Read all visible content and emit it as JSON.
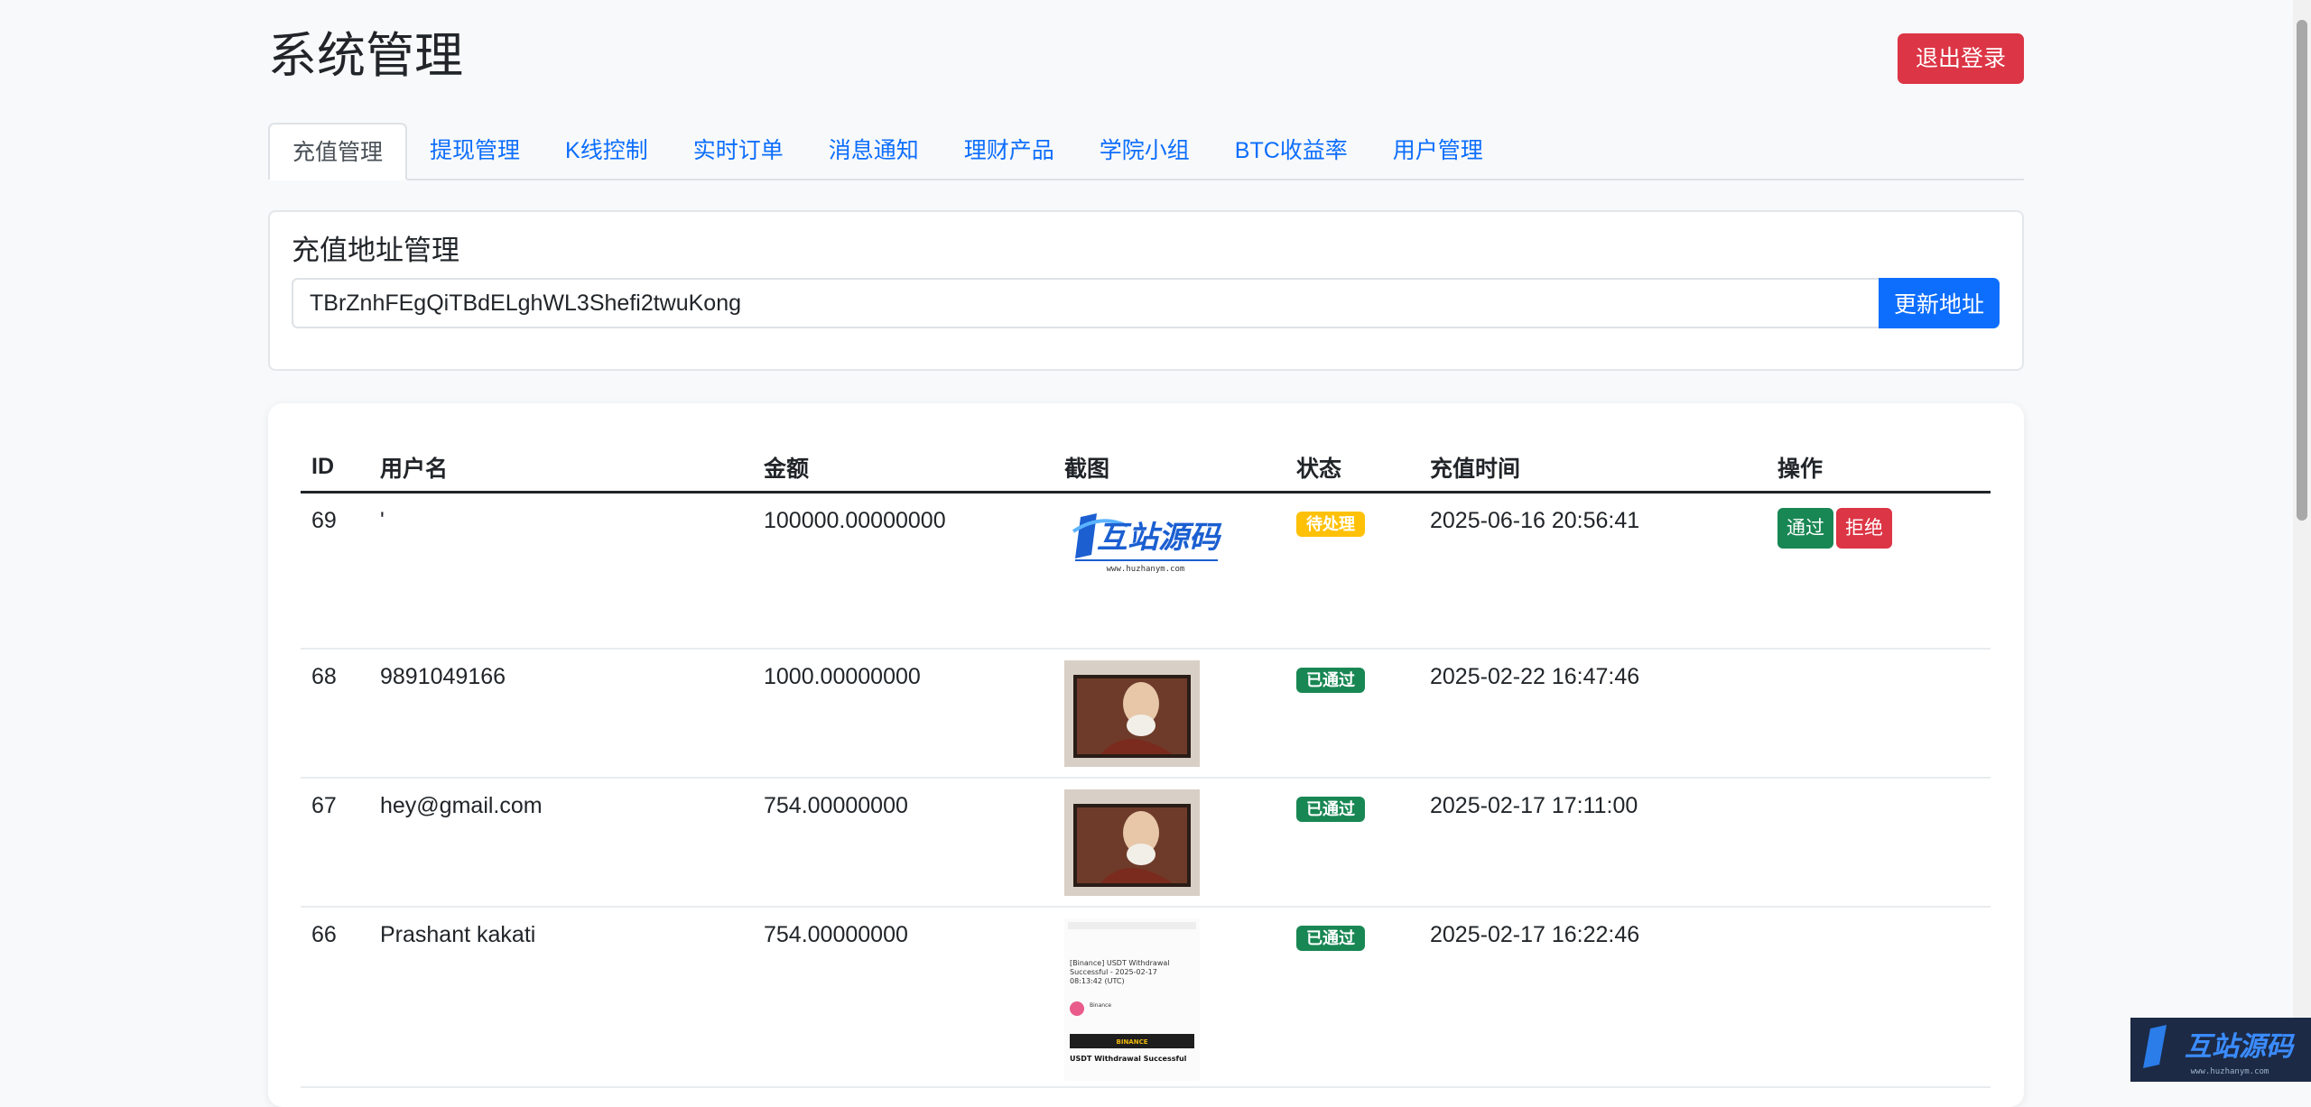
{
  "header": {
    "title": "系统管理",
    "logout_label": "退出登录"
  },
  "tabs": [
    {
      "label": "充值管理",
      "active": true
    },
    {
      "label": "提现管理"
    },
    {
      "label": "K线控制"
    },
    {
      "label": "实时订单"
    },
    {
      "label": "消息通知"
    },
    {
      "label": "理财产品"
    },
    {
      "label": "学院小组"
    },
    {
      "label": "BTC收益率"
    },
    {
      "label": "用户管理"
    }
  ],
  "address": {
    "title": "充值地址管理",
    "value": "TBrZnhFEgQiTBdELghWL3Shefi2twuKong",
    "update_label": "更新地址"
  },
  "table": {
    "columns": [
      "ID",
      "用户名",
      "金额",
      "截图",
      "状态",
      "充值时间",
      "操作"
    ],
    "rows": [
      {
        "id": "69",
        "username": "'",
        "amount": "100000.00000000",
        "status": "待处理",
        "time": "2025-06-16 20:56:41",
        "thumb_brand": "互站源码",
        "thumb_url": "www.huzhanym.com",
        "actions": [
          "通过",
          "拒绝"
        ]
      },
      {
        "id": "68",
        "username": "9891049166",
        "amount": "1000.00000000",
        "status": "已通过",
        "time": "2025-02-22 16:47:46"
      },
      {
        "id": "67",
        "username": "hey@gmail.com",
        "amount": "754.00000000",
        "status": "已通过",
        "time": "2025-02-17 17:11:00"
      },
      {
        "id": "66",
        "username": "Prashant kakati",
        "amount": "754.00000000",
        "status": "已通过",
        "time": "2025-02-17 16:22:46",
        "thumb_lines": [
          "[Binance] USDT Withdrawal",
          "Successful - 2025-02-17",
          "08:13:42 (UTC)",
          "Binance",
          "BINANCE",
          "USDT Withdrawal Successful"
        ]
      }
    ]
  },
  "watermark": {
    "brand": "互站源码",
    "url": "www.huzhanym.com"
  },
  "colors": {
    "primary": "#0d6efd",
    "danger": "#dc3545",
    "success": "#198754",
    "warning": "#ffc107"
  }
}
